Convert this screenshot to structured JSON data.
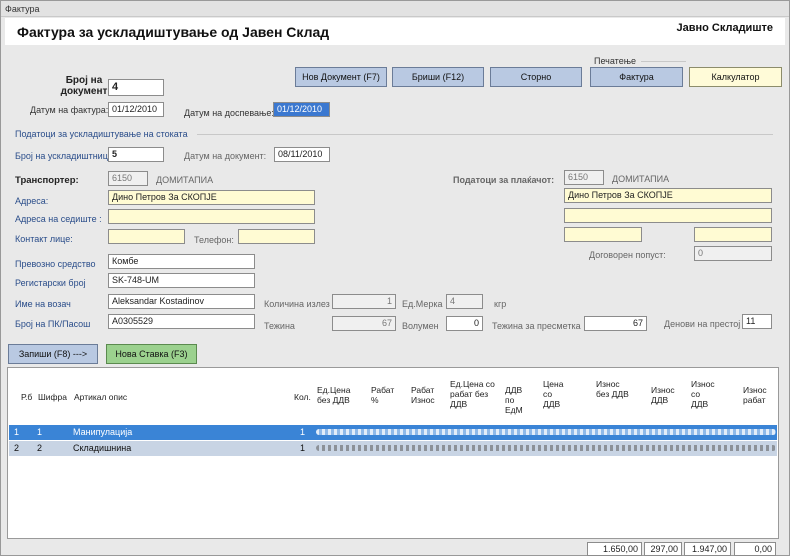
{
  "window": {
    "title": "Фактура"
  },
  "header": {
    "title": "Фактура за ускладиштување од Јавен Склад",
    "subtitle": "Јавно Складиште"
  },
  "doc": {
    "number_label": "Број на документ",
    "number_value": "4",
    "invoice_date_label": "Датум на фактура:",
    "invoice_date_value": "01/12/2010",
    "due_date_label": "Датум на доспевање:",
    "due_date_value": "01/12/2010"
  },
  "toolbar": {
    "print_group_label": "Печатење",
    "new_doc": "Нов Документ (F7)",
    "delete": "Бриши (F12)",
    "storno": "Сторно",
    "invoice": "Фактура",
    "calculator": "Калкулатор"
  },
  "release": {
    "group_label": "Податоци за ускладиштување на стоката",
    "number_label": "Број на ускладиштница",
    "number_value": "5",
    "doc_date_label": "Датум на документ:",
    "doc_date_value": "08/11/2010"
  },
  "transporter": {
    "label": "Транспортер:",
    "code": "6150",
    "name": "ДОМИТАПИА",
    "address_label": "Адреса:",
    "address_value": "Дино Петров За СКОПЈЕ",
    "hq_address_label": "Адреса на седиште :",
    "hq_address_value": "",
    "contact_label": "Контакт лице:",
    "contact_value": "",
    "phone_label": "Телефон:",
    "phone_value": "",
    "vehicle_label": "Превозно средство",
    "vehicle_value": "Комбе",
    "reg_label": "Регистарски број",
    "reg_value": "SK-748-UM",
    "driver_label": "Име на возач",
    "driver_value": "Aleksandar Kostadinov",
    "id_label": "Број на ПК/Пасош",
    "id_value": "A0305529"
  },
  "payer": {
    "label": "Податоци за плаќачот:",
    "code": "6150",
    "name": "ДОМИТАПИА",
    "address_value": "Дино Петров За СКОПЈЕ",
    "line2": "",
    "line3a": "",
    "line3b": "",
    "discount_label": "Договорен попуст:",
    "discount_value": "0"
  },
  "quantities": {
    "qty_out_label": "Количина излез",
    "qty_out_value": "1",
    "unit_label": "Ед.Мерка",
    "unit_value": "4",
    "unit_suffix": "кгр",
    "weight_label": "Тежина",
    "weight_value": "67",
    "volume_label": "Волумен",
    "volume_value": "0",
    "calc_weight_label": "Тежина за пресметка",
    "calc_weight_value": "67",
    "days_label": "Денови на престој",
    "days_value": "11"
  },
  "actions": {
    "save": "Запиши (F8) --->",
    "new_item": "Нова Ставка (F3)"
  },
  "grid": {
    "columns": [
      "Р.б",
      "Шифра",
      "Артикал опис",
      "Кол.",
      "Ед.Цена без ДДВ",
      "Рабат %",
      "Рабат Износ",
      "Ед.Цена со рабат без ДДВ",
      "ДДВ по ЕдМ",
      "Цена со ДДВ",
      "Износ без ДДВ",
      "Износ ДДВ",
      "Износ со ДДВ",
      "Износ рабат"
    ],
    "rows": [
      {
        "rb": "1",
        "code": "1",
        "desc": "Манипулација",
        "qty": "1"
      },
      {
        "rb": "2",
        "code": "2",
        "desc": "Складишнина",
        "qty": "1"
      }
    ]
  },
  "totals": {
    "without_vat": "1.650,00",
    "vat": "297,00",
    "with_vat": "1.947,00",
    "discount": "0,00"
  }
}
